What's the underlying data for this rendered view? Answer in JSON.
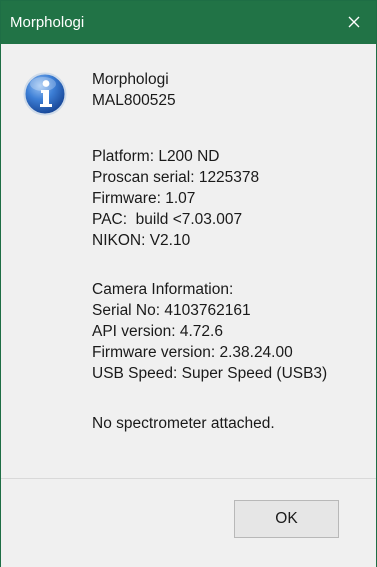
{
  "window": {
    "title": "Morphologi",
    "close_icon": "close-icon",
    "title_bar_color": "#217346"
  },
  "dialog": {
    "icon": "info-icon",
    "header": {
      "product": "Morphologi",
      "serial": "MAL800525"
    },
    "hardware": [
      "Platform: L200 ND",
      "Proscan serial: 1225378",
      "Firmware: 1.07",
      "PAC:  build <7.03.007",
      "NIKON: V2.10"
    ],
    "camera": [
      "Camera Information:",
      "Serial No: 4103762161",
      "API version: 4.72.6",
      "Firmware version: 2.38.24.00",
      "USB Speed: Super Speed (USB3)"
    ],
    "spectrometer": "No spectrometer attached."
  },
  "buttons": {
    "ok_label": "OK"
  }
}
